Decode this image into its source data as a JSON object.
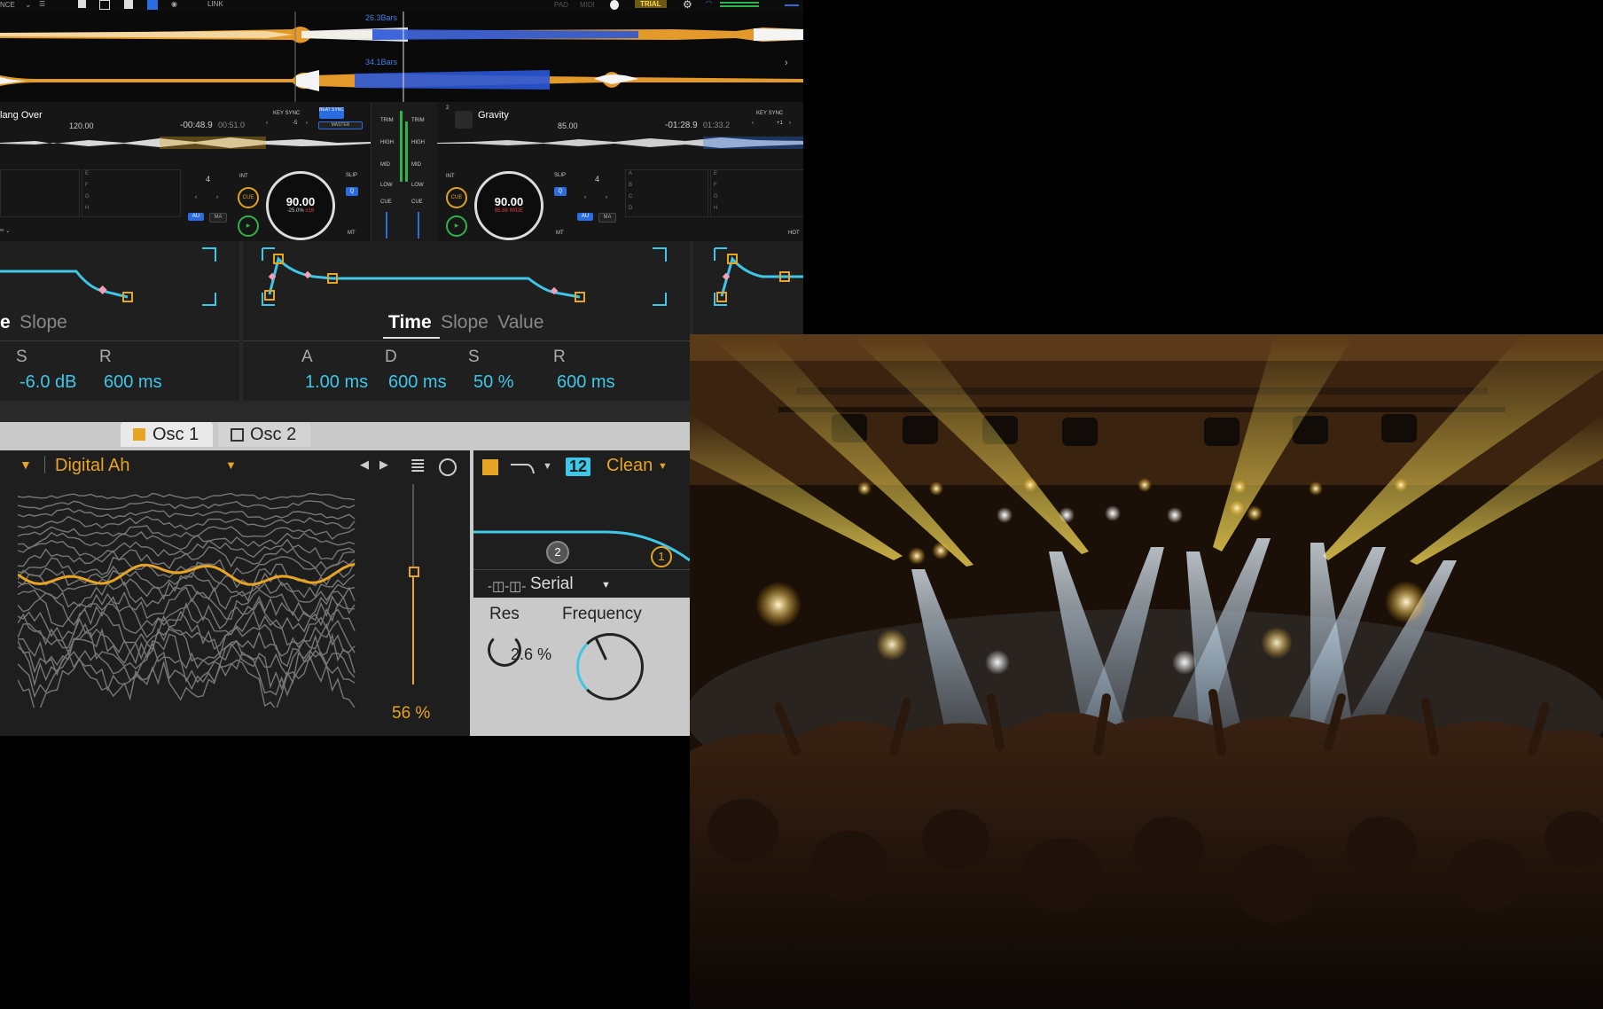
{
  "dj": {
    "topbar": {
      "left_label": "NCE",
      "link_label": "LINK",
      "pad_label": "PAD",
      "midi_label": "MIDI",
      "trial_label": "TRIAL"
    },
    "wave1_bars": "26.3Bars",
    "wave2_bars": "34.1Bars",
    "deck1": {
      "title": "lang Over",
      "bpm": "120.00",
      "time_remaining": "-00:48.9",
      "time_total": "00:51.0",
      "key_sync": "KEY SYNC",
      "key_offset": "-5",
      "beat_sync": "BEAT SYNC",
      "master": "MASTER",
      "jog_bpm": "90.00",
      "jog_pitch": "-25.0%",
      "jog_pitch_b": "±16",
      "quant": "4",
      "int": "INT",
      "slip": "SLIP",
      "q": "Q",
      "cue": "CUE",
      "au": "AU",
      "ma": "MA",
      "mt": "MT",
      "pads": [
        "E",
        "F",
        "G",
        "H"
      ]
    },
    "mixer": {
      "trim": "TRIM",
      "high": "HIGH",
      "mid": "MID",
      "low": "LOW",
      "cue": "CUE"
    },
    "deck2": {
      "number": "2",
      "title": "Gravity",
      "bpm": "85.00",
      "time_remaining": "-01:28.9",
      "time_total": "01:33.2",
      "key_sync": "KEY SYNC",
      "key_offset": "+1",
      "jog_bpm": "90.00",
      "jog_pitch": "85.88",
      "jog_pitch_b": "WIDE",
      "quant": "4",
      "int": "INT",
      "slip": "SLIP",
      "q": "Q",
      "cue": "CUE",
      "au": "AU",
      "ma": "MA",
      "mt": "MT",
      "hot": "HOT",
      "pads_left": [
        "A",
        "B",
        "C",
        "D"
      ],
      "pads_right": [
        "E",
        "F",
        "G",
        "H"
      ]
    }
  },
  "envelope": {
    "left_tabs": [
      "e",
      "Slope"
    ],
    "left_adsr": [
      {
        "letter": "S",
        "value": "-6.0 dB"
      },
      {
        "letter": "R",
        "value": "600 ms"
      }
    ],
    "mid_tabs": [
      "Time",
      "Slope",
      "Value"
    ],
    "mid_adsr": [
      {
        "letter": "A",
        "value": "1.00 ms"
      },
      {
        "letter": "D",
        "value": "600 ms"
      },
      {
        "letter": "S",
        "value": "50 %"
      },
      {
        "letter": "R",
        "value": "600 ms"
      }
    ]
  },
  "osc": {
    "tab1": "Osc 1",
    "tab2": "Osc 2",
    "wavetable_name": "Digital Ah",
    "position": "56 %",
    "position_level": 0.56,
    "filter_slope": "12",
    "filter_type": "Clean",
    "routing": "Serial",
    "filter_badge_2": "2",
    "filter_badge_1": "1",
    "res_label": "Res",
    "res_value": "2.6 %",
    "freq_label": "Frequency"
  },
  "colors": {
    "accent_orange": "#e8a424",
    "accent_cyan": "#3fc7e8",
    "deck_blue": "#2a6de0"
  }
}
